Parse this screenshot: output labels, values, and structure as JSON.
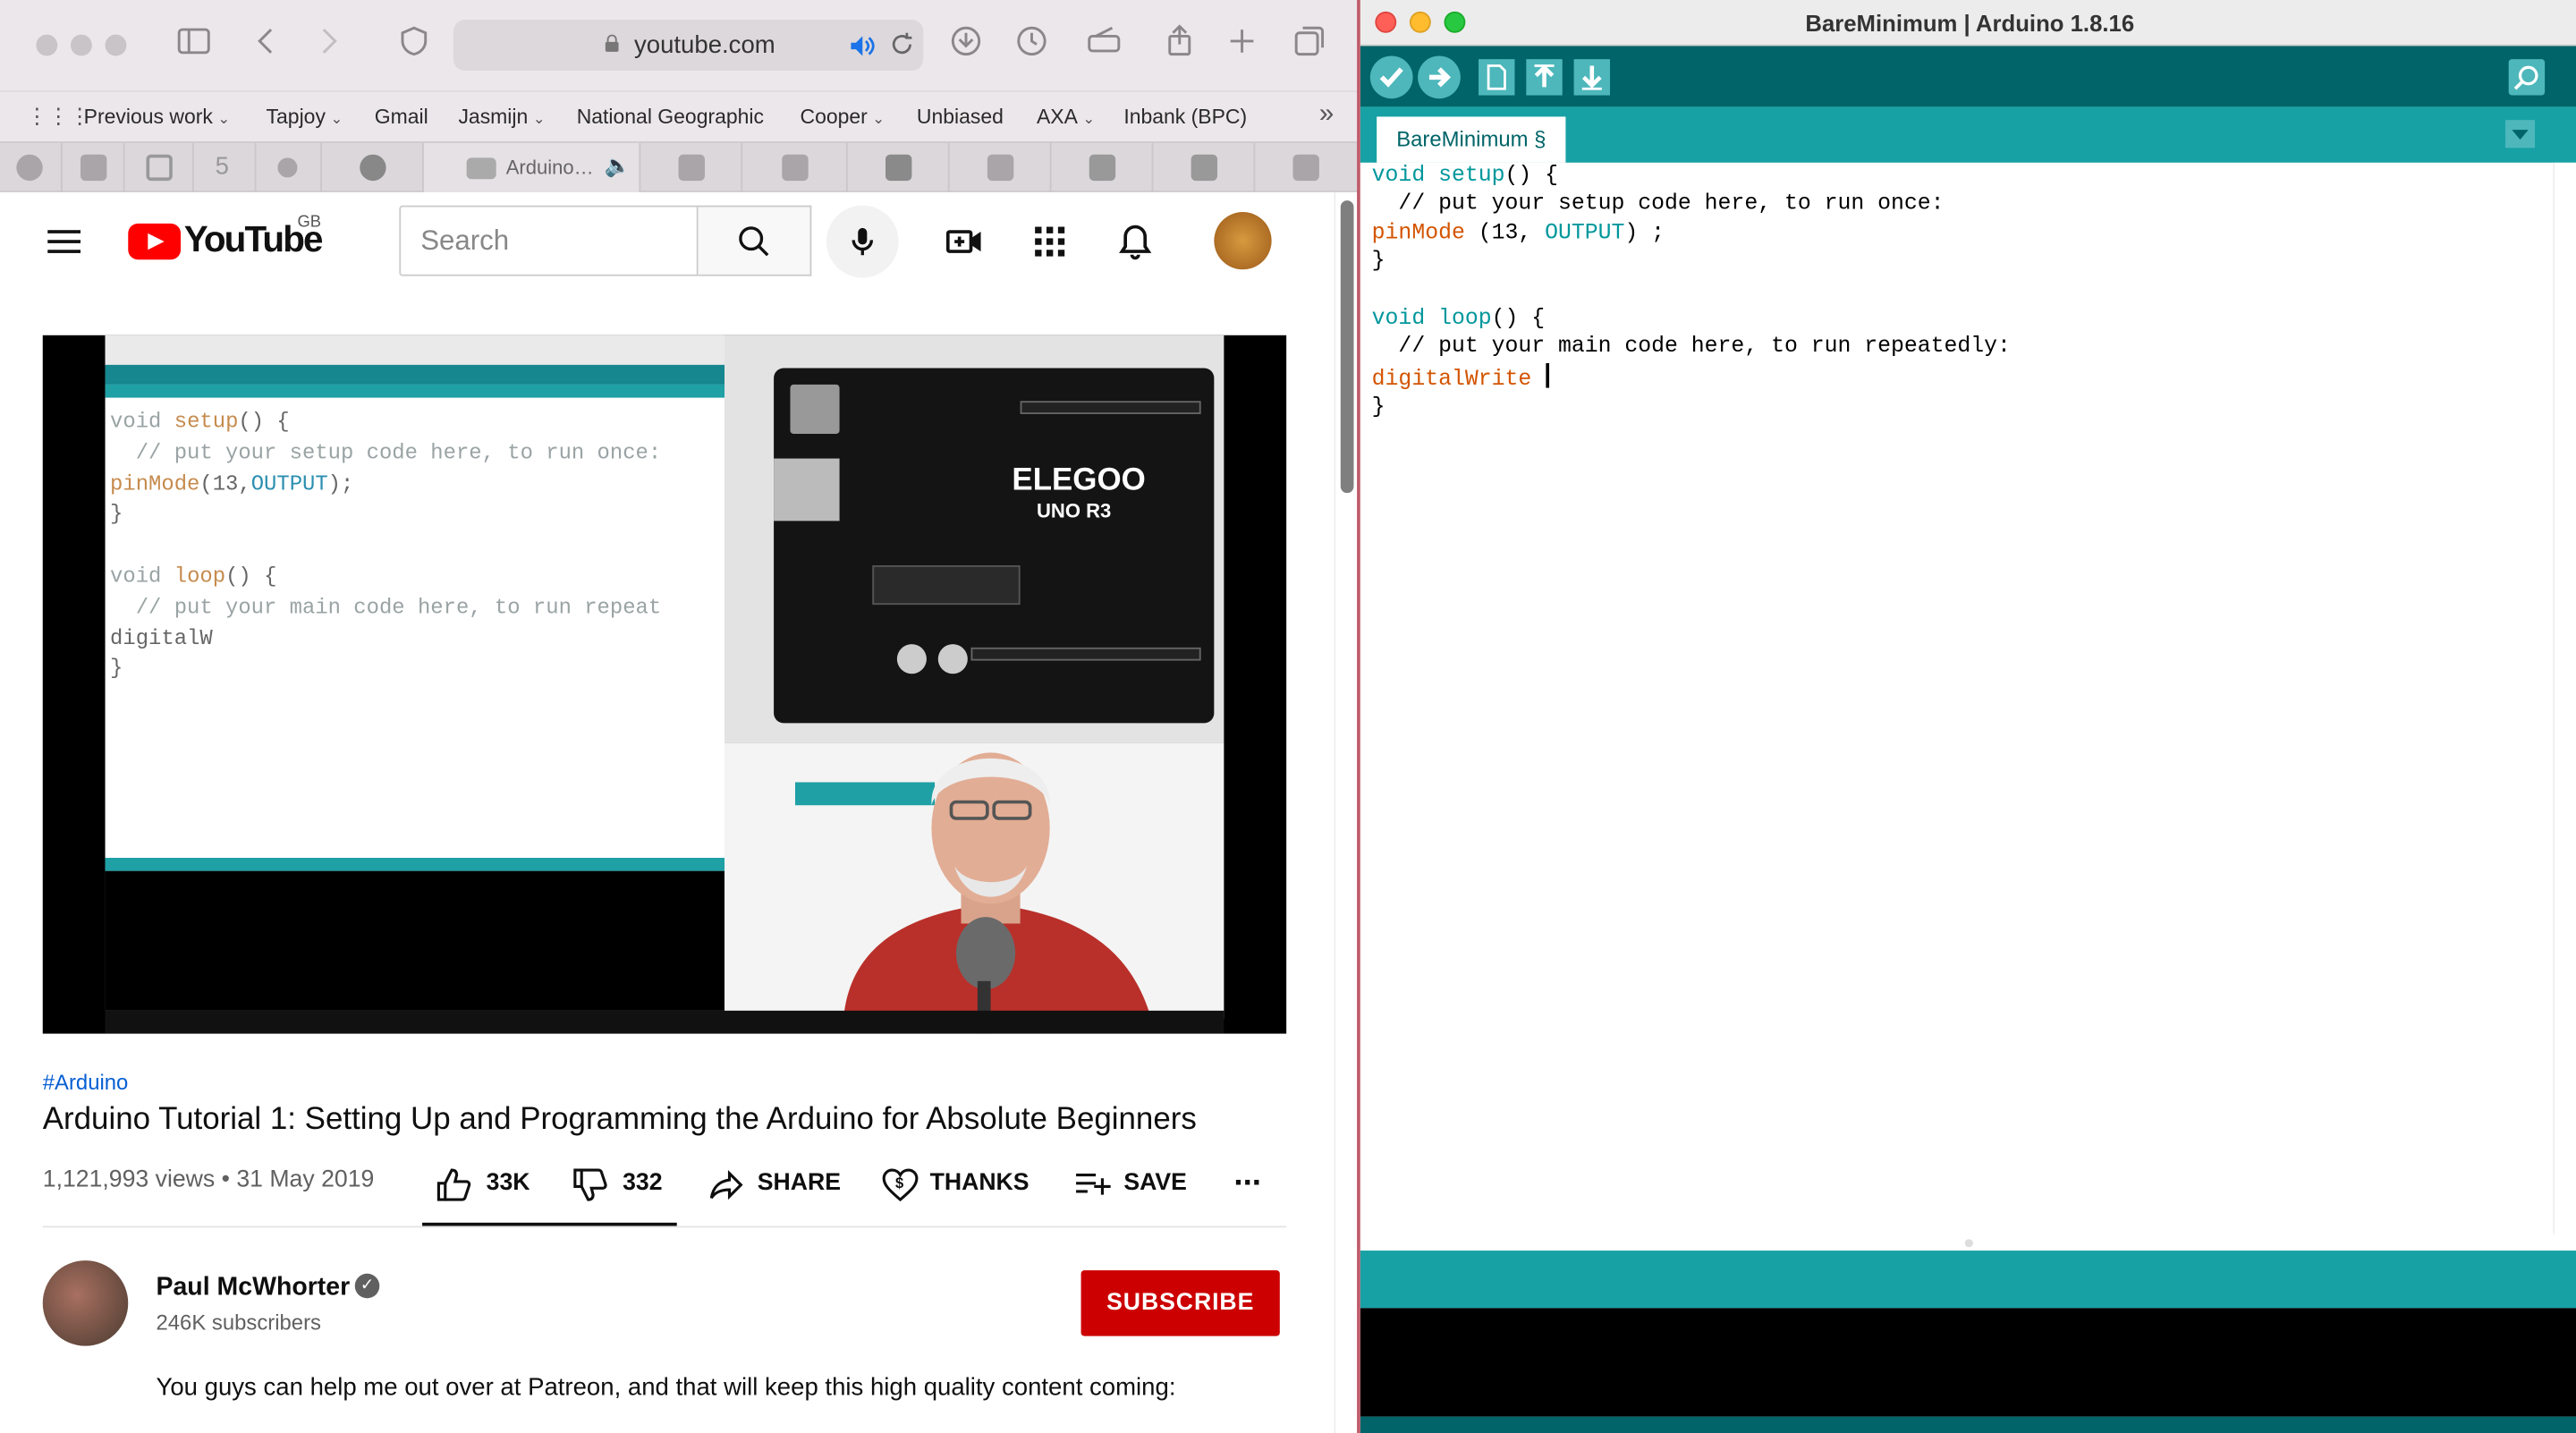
{
  "safari": {
    "url": "youtube.com",
    "bookmarks": [
      {
        "label": "Previous work",
        "dropdown": true
      },
      {
        "label": "Tapjoy",
        "dropdown": true
      },
      {
        "label": "Gmail",
        "dropdown": false
      },
      {
        "label": "Jasmijn",
        "dropdown": true
      },
      {
        "label": "National Geographic",
        "dropdown": false
      },
      {
        "label": "Cooper",
        "dropdown": true
      },
      {
        "label": "Unbiased",
        "dropdown": false
      },
      {
        "label": "AXA",
        "dropdown": true
      },
      {
        "label": "Inbank (BPC)",
        "dropdown": false
      }
    ],
    "active_tab_label": "Arduino…",
    "pinned_tab_5": "5"
  },
  "youtube": {
    "logo_text": "YouTube",
    "region": "GB",
    "search_placeholder": "Search",
    "video": {
      "hashtag": "#Arduino",
      "title": "Arduino Tutorial 1: Setting Up and Programming the Arduino for Absolute Beginners",
      "meta": "1,121,993 views • 31 May 2019",
      "likes": "33K",
      "dislikes": "332",
      "share": "SHARE",
      "thanks": "THANKS",
      "save": "SAVE",
      "more": "..."
    },
    "thumbnail_code": {
      "line1_kw": "void",
      "line1_fn": "setup",
      "line1_rest": "() {",
      "line2": "  // put your setup code here, to run once:",
      "line3_fn": "pinMode",
      "line3_a": "(13,",
      "line3_const": "OUTPUT",
      "line3_b": ");",
      "line4": "}",
      "line6_kw": "void",
      "line6_fn": "loop",
      "line6_rest": "() {",
      "line7": "  // put your main code here, to run repeat",
      "line8": "digitalW",
      "line9": "}",
      "board_brand": "ELEGOO",
      "board_model": "UNO R3"
    },
    "channel": {
      "name": "Paul McWhorter",
      "subscribers": "246K subscribers",
      "subscribe_label": "SUBSCRIBE"
    },
    "description": "You guys can help me out over at Patreon, and that will keep this high quality content coming:"
  },
  "arduino": {
    "window_title": "BareMinimum | Arduino 1.8.16",
    "tab_label": "BareMinimum §",
    "code": {
      "l1_kw": "void",
      "l1_fn": "setup",
      "l1_rest": "() {",
      "l2": "  // put your setup code here, to run once:",
      "l3_fn": "pinMode",
      "l3_a": " (13, ",
      "l3_const": "OUTPUT",
      "l3_b": ") ;",
      "l4": "}",
      "l6_kw": "void",
      "l6_fn": "loop",
      "l6_rest": "() {",
      "l7": "  // put your main code here, to run repeatedly:",
      "l8_fn": "digitalWrite",
      "l8_rest": " ",
      "l9": "}"
    },
    "colors": {
      "teal_dark": "#006468",
      "teal": "#17a1a5",
      "keyword": "#00979c",
      "function": "#d35400"
    }
  }
}
